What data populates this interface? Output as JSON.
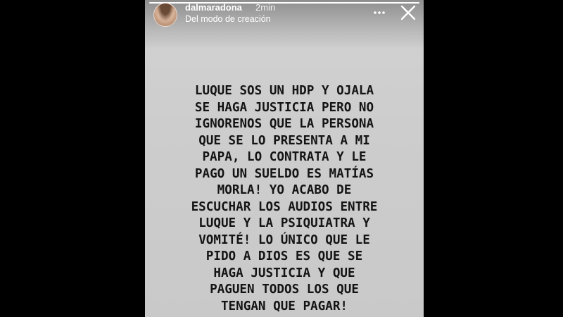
{
  "story": {
    "username": "dalmaradona",
    "time_ago": "2min",
    "subtitle": "Del modo de creación",
    "progress": 1.0,
    "background_color": "#cdcdcd",
    "text_color": "#141414",
    "text": "LUQUE SOS UN HDP Y OJALA\nSE HAGA JUSTICIA PERO NO\nIGNORENOS QUE LA PERSONA\nQUE SE LO PRESENTA A MI\nPAPA, LO CONTRATA Y LE\nPAGO UN SUELDO ES MATÍAS\nMORLA! YO ACABO DE\nESCUCHAR LOS AUDIOS ENTRE\nLUQUE Y LA PSIQUIATRA Y\nVOMITÉ! LO ÚNICO QUE LE\nPIDO A DIOS ES QUE SE\nHAGA JUSTICIA Y QUE\nPAGUEN TODOS LOS QUE\nTENGAN QUE PAGAR!"
  },
  "icons": {
    "more": "more-horizontal-icon",
    "close": "close-icon"
  }
}
